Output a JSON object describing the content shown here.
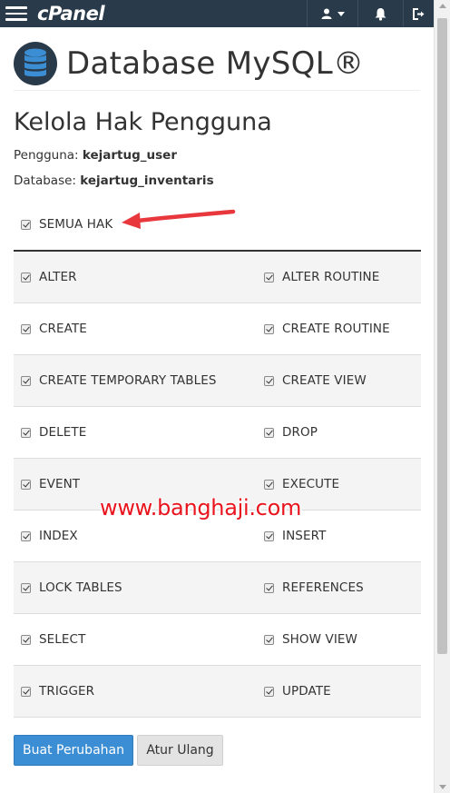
{
  "topbar": {
    "logo": "cPanel",
    "icons": [
      "menu-icon",
      "user-icon",
      "caret-down-icon",
      "bell-icon",
      "logout-icon"
    ]
  },
  "header": {
    "title": "Database MySQL®",
    "icon": "database-icon"
  },
  "section": {
    "title": "Kelola Hak Pengguna",
    "user_label": "Pengguna: ",
    "user_value": "kejartug_user",
    "db_label": "Database: ",
    "db_value": "kejartug_inventaris"
  },
  "all_privileges": {
    "label": "SEMUA HAK",
    "checked": true
  },
  "privileges": [
    {
      "left": "ALTER",
      "right": "ALTER ROUTINE"
    },
    {
      "left": "CREATE",
      "right": "CREATE ROUTINE"
    },
    {
      "left": "CREATE TEMPORARY TABLES",
      "right": "CREATE VIEW"
    },
    {
      "left": "DELETE",
      "right": "DROP"
    },
    {
      "left": "EVENT",
      "right": "EXECUTE"
    },
    {
      "left": "INDEX",
      "right": "INSERT"
    },
    {
      "left": "LOCK TABLES",
      "right": "REFERENCES"
    },
    {
      "left": "SELECT",
      "right": "SHOW VIEW"
    },
    {
      "left": "TRIGGER",
      "right": "UPDATE"
    }
  ],
  "watermark": "www.banghaji.com",
  "buttons": {
    "save": "Buat Perubahan",
    "reset": "Atur Ulang"
  },
  "colors": {
    "topbar": "#293a4a",
    "primary": "#3b8ed4",
    "arrow": "#e8383d",
    "watermark": "#e8141e"
  }
}
